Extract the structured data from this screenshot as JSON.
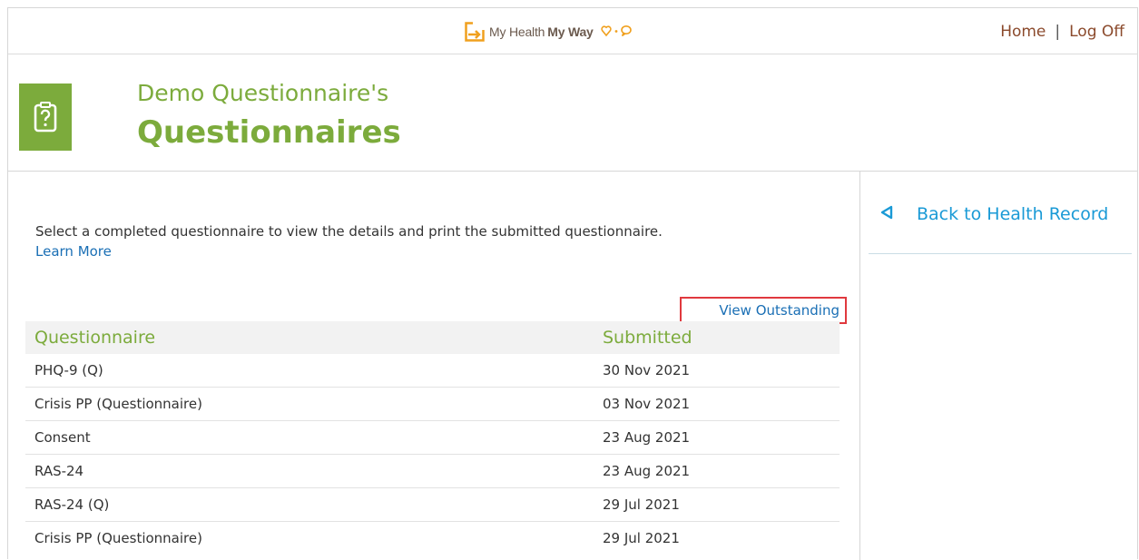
{
  "header": {
    "logo_prefix": "My Health",
    "logo_bold": "My Way",
    "home": "Home",
    "separator": "|",
    "logoff": "Log Off"
  },
  "title": {
    "subtitle": "Demo Questionnaire's",
    "main": "Questionnaires",
    "icon": "clipboard-question-icon"
  },
  "content": {
    "intro": "Select a completed questionnaire to view the details and print the submitted questionnaire.",
    "learn_more": "Learn More",
    "view_outstanding": "View Outstanding"
  },
  "table": {
    "headers": [
      "Questionnaire",
      "Submitted"
    ],
    "rows": [
      [
        "PHQ-9 (Q)",
        "30 Nov 2021"
      ],
      [
        "Crisis PP (Questionnaire)",
        "03 Nov 2021"
      ],
      [
        "Consent",
        "23 Aug 2021"
      ],
      [
        "RAS-24",
        "23 Aug 2021"
      ],
      [
        "RAS-24 (Q)",
        "29 Jul 2021"
      ],
      [
        "Crisis PP (Questionnaire)",
        "29 Jul 2021"
      ]
    ]
  },
  "side": {
    "back": "Back to Health Record",
    "back_icon": "triangle-left-icon"
  },
  "colors": {
    "accent_green": "#7cab3c",
    "link_blue": "#1a6fb5",
    "back_blue": "#1a9ad6",
    "highlight_red": "#e0393e",
    "header_link": "#8b4a2c"
  }
}
